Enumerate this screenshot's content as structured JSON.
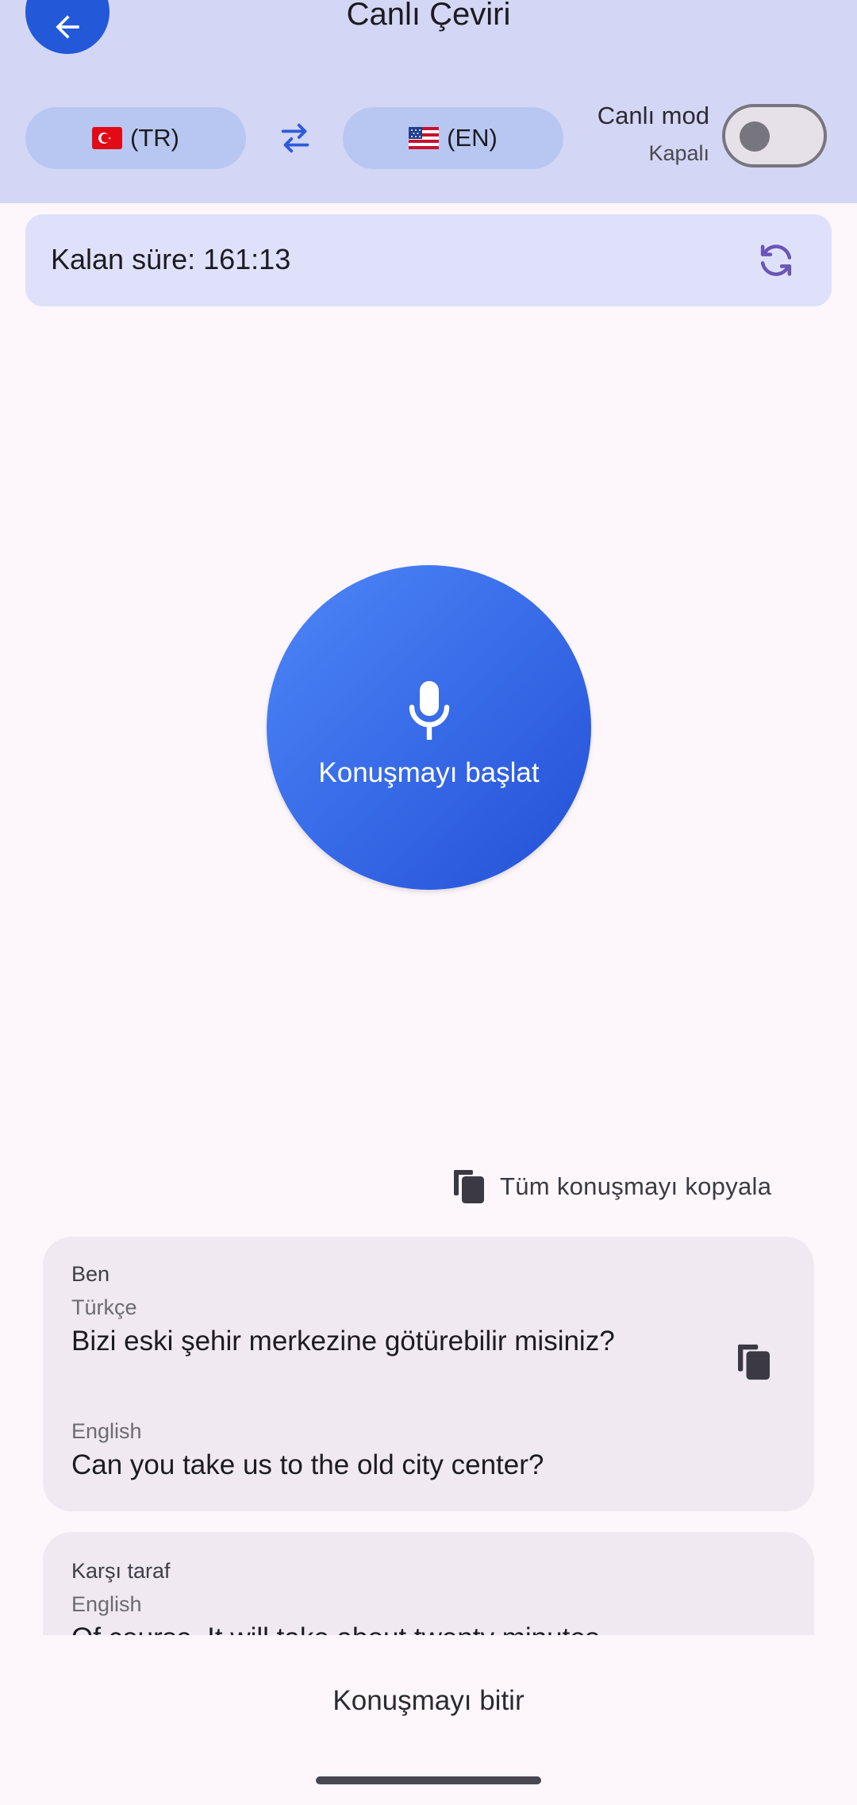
{
  "header": {
    "title": "Canlı Çeviri",
    "source_lang": {
      "flag": "turkey-flag",
      "code": "(TR)"
    },
    "target_lang": {
      "flag": "usa-flag",
      "code": "(EN)"
    },
    "live_mode_label": "Canlı mod",
    "live_mode_status": "Kapalı",
    "live_mode_on": false
  },
  "timer": {
    "text": "Kalan süre: 161:13"
  },
  "mic": {
    "label": "Konuşmayı başlat",
    "icon": "microphone-icon"
  },
  "copy_all": {
    "label": "Tüm konuşmayı kopyala"
  },
  "messages": [
    {
      "speaker": "Ben",
      "source_lang": "Türkçe",
      "source_text": "Bizi eski şehir merkezine götürebilir misiniz?",
      "target_lang": "English",
      "target_text": "Can you take us to the old city center?"
    },
    {
      "speaker": "Karşı taraf",
      "source_lang": "English",
      "source_text": "Of course. It will take about twenty minutes."
    }
  ],
  "bottom": {
    "end_label": "Konuşmayı bitir"
  },
  "colors": {
    "header_bg": "#d3d6f4",
    "accent": "#2358d8",
    "pill_bg": "#b8c7f1",
    "card_bg": "#f0e9f2",
    "refresh_icon": "#6a55b7"
  }
}
